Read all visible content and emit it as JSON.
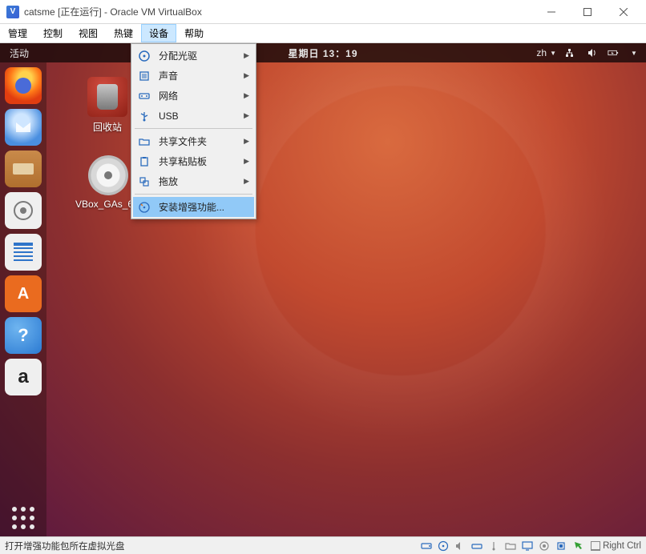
{
  "window": {
    "title": "catsme [正在运行] - Oracle VM VirtualBox",
    "minimize_hint": "最小化",
    "maximize_hint": "最大化",
    "close_hint": "关闭"
  },
  "menubar": {
    "items": [
      "管理",
      "控制",
      "视图",
      "热键",
      "设备",
      "帮助"
    ],
    "open_index": 4
  },
  "devices_menu": {
    "items": [
      {
        "icon": "disc-icon",
        "label": "分配光驱",
        "submenu": true
      },
      {
        "icon": "sound-icon",
        "label": "声音",
        "submenu": true
      },
      {
        "icon": "network-icon",
        "label": "网络",
        "submenu": true
      },
      {
        "icon": "usb-icon",
        "label": "USB",
        "submenu": true
      },
      {
        "sep": true
      },
      {
        "icon": "folder-icon",
        "label": "共享文件夹",
        "submenu": true
      },
      {
        "icon": "clipboard-icon",
        "label": "共享粘贴板",
        "submenu": true
      },
      {
        "icon": "drag-icon",
        "label": "拖放",
        "submenu": true
      },
      {
        "sep": true
      },
      {
        "icon": "disc-install-icon",
        "label": "安装增强功能...",
        "submenu": false,
        "selected": true
      }
    ]
  },
  "guest": {
    "activities": "活动",
    "clock": "星期日 13：19",
    "ime_label": "zh",
    "desktop": {
      "trash_label": "回收站",
      "disc_label": "VBox_GAs_6.0.8"
    },
    "launcher_names": [
      "firefox",
      "thunderbird",
      "files",
      "rhythmbox",
      "writer",
      "software",
      "help",
      "amazon",
      "show-apps"
    ]
  },
  "statusbar": {
    "message": "打开增强功能包所在虚拟光盘",
    "hostkey": "Right Ctrl"
  }
}
